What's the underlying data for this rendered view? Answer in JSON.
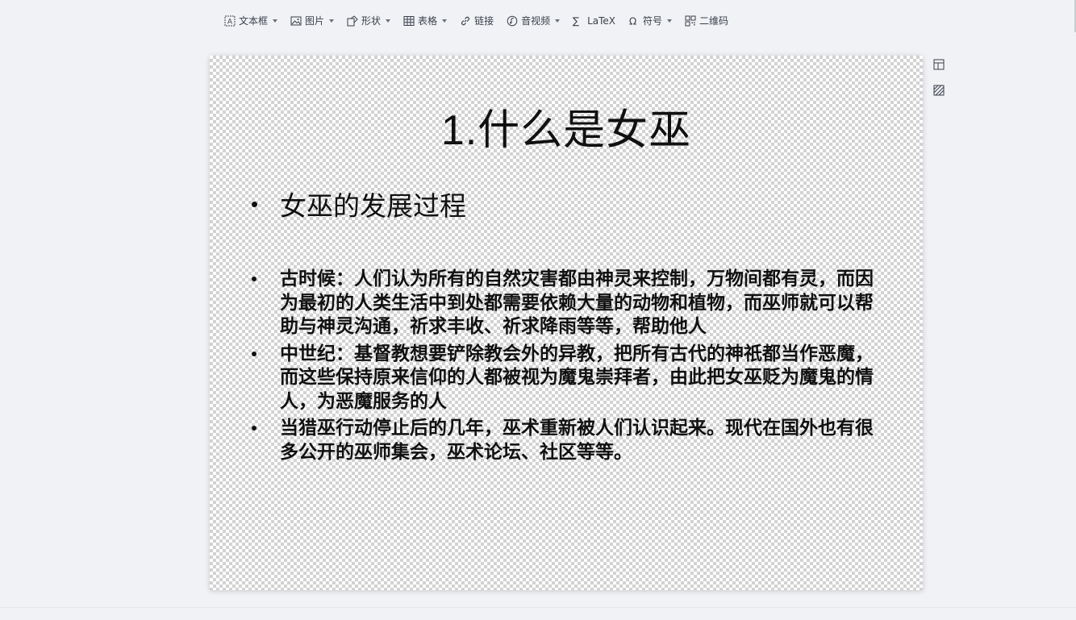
{
  "toolbar": {
    "items": [
      {
        "label": "文本框",
        "icon": "text-box-icon",
        "has_caret": true
      },
      {
        "label": "图片",
        "icon": "image-icon",
        "has_caret": true
      },
      {
        "label": "形状",
        "icon": "shape-icon",
        "has_caret": true
      },
      {
        "label": "表格",
        "icon": "table-icon",
        "has_caret": true
      },
      {
        "label": "链接",
        "icon": "link-icon",
        "has_caret": false
      },
      {
        "label": "音视频",
        "icon": "media-icon",
        "has_caret": true
      },
      {
        "label": "LaTeX",
        "icon": "formula-icon",
        "has_caret": false
      },
      {
        "label": "符号",
        "icon": "omega-icon",
        "has_caret": true
      },
      {
        "label": "二维码",
        "icon": "qr-code-icon",
        "has_caret": false
      }
    ]
  },
  "slide": {
    "title": "1.什么是女巫",
    "heading": "女巫的发展过程",
    "bullets": [
      "古时候：人们认为所有的自然灾害都由神灵来控制，万物间都有灵，而因为最初的人类生活中到处都需要依赖大量的动物和植物，而巫师就可以帮助与神灵沟通，祈求丰收、祈求降雨等等，帮助他人",
      "中世纪：基督教想要铲除教会外的异教，把所有古代的神祇都当作恶魔，而这些保持原来信仰的人都被视为魔鬼崇拜者，由此把女巫贬为魔鬼的情人，为恶魔服务的人",
      "当猎巫行动停止后的几年，巫术重新被人们认识起来。现代在国外也有很多公开的巫师集会，巫术论坛、社区等等。"
    ]
  },
  "side_tools": [
    "layout-icon",
    "background-icon"
  ]
}
